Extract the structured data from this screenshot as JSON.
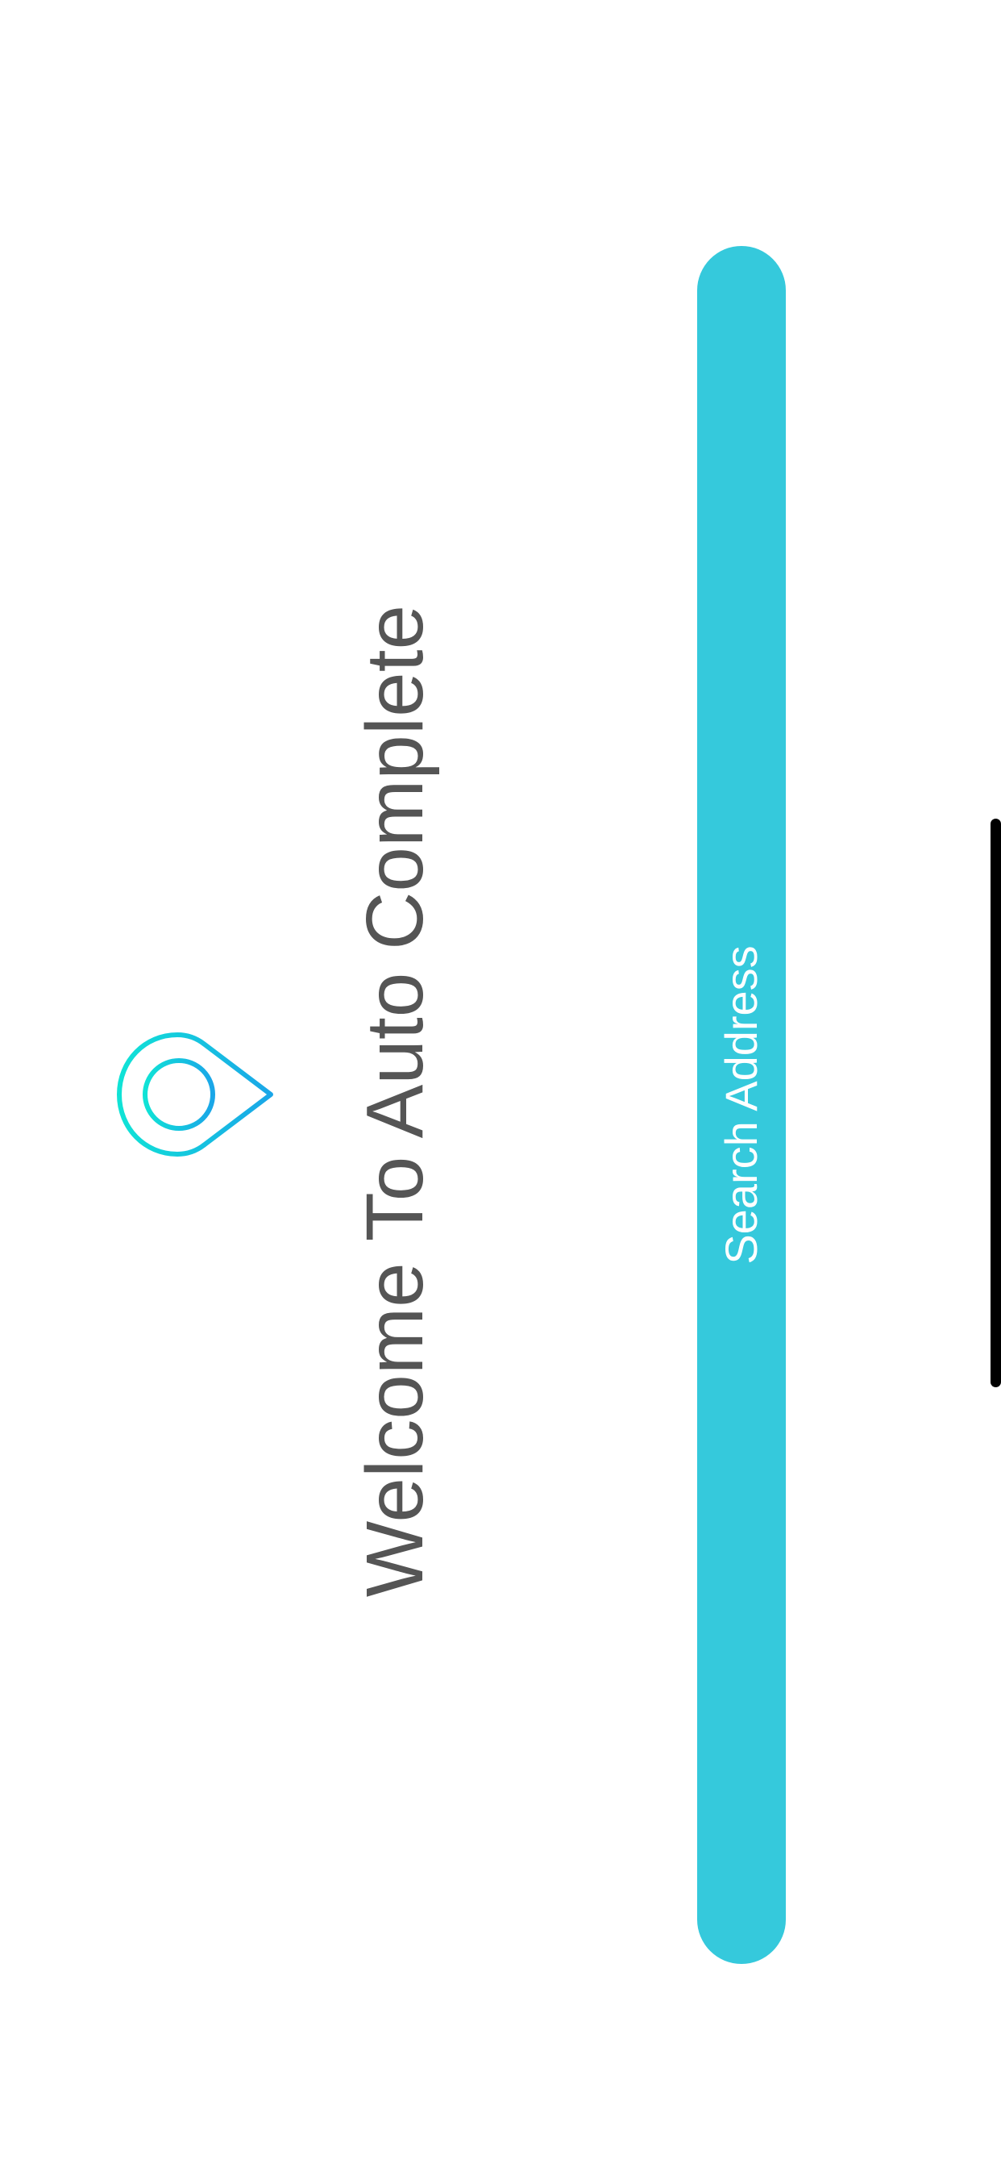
{
  "welcome": {
    "title": "Welcome To Auto Complete",
    "icon": "location-pin-icon"
  },
  "search_button": {
    "label": "Search Address"
  },
  "colors": {
    "accent": "#35c9dc",
    "title_text": "#555555",
    "button_text": "#ffffff",
    "background": "#ffffff",
    "icon_gradient_start": "#10e3d6",
    "icon_gradient_end": "#1aa6e8"
  }
}
